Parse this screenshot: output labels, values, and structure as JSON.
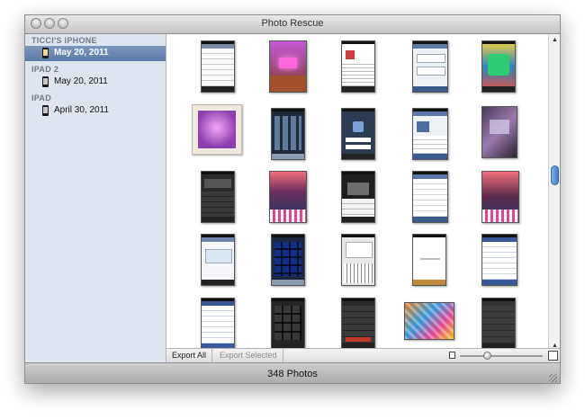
{
  "window": {
    "title": "Photo Rescue"
  },
  "sidebar": {
    "groups": [
      {
        "title": "TICCI'S IPHONE",
        "items": [
          {
            "label": "May 20, 2011",
            "selected": true
          }
        ]
      },
      {
        "title": "IPAD 2",
        "items": [
          {
            "label": "May 20, 2011",
            "selected": false
          }
        ]
      },
      {
        "title": "IPAD",
        "items": [
          {
            "label": "April 30, 2011",
            "selected": false
          }
        ]
      }
    ]
  },
  "toolbar": {
    "export_all": "Export All",
    "export_selected": "Export Selected",
    "zoom_level": 0.3
  },
  "status": {
    "count": "348 Photos"
  },
  "colors": {
    "selection": "#5a7ba8",
    "scroll_knob": "#3e7fd0",
    "sidebar_bg": "#dfe5ee"
  },
  "thumbnails": [
    {
      "kind": "settings screenshot"
    },
    {
      "kind": "purple desk photo"
    },
    {
      "kind": "web article screenshot"
    },
    {
      "kind": "web form screenshot"
    },
    {
      "kind": "colorful app screenshot"
    },
    {
      "kind": "purple monitor photo"
    },
    {
      "kind": "home screen screenshot"
    },
    {
      "kind": "app login screenshot"
    },
    {
      "kind": "messages screenshot"
    },
    {
      "kind": "desk photo"
    },
    {
      "kind": "dark app screenshot"
    },
    {
      "kind": "colorful poster photo"
    },
    {
      "kind": "dark settings screenshot"
    },
    {
      "kind": "list app screenshot"
    },
    {
      "kind": "colorful poster photo"
    },
    {
      "kind": "web page screenshot"
    },
    {
      "kind": "app store screenshot"
    },
    {
      "kind": "keyboard screenshot"
    },
    {
      "kind": "blank loading screenshot"
    },
    {
      "kind": "facebook screenshot"
    },
    {
      "kind": "facebook feed screenshot"
    },
    {
      "kind": "dark grid screenshot"
    },
    {
      "kind": "dark menu screenshot"
    },
    {
      "kind": "colorful artwork photo"
    },
    {
      "kind": "dark list screenshot"
    }
  ],
  "icons": {
    "window_close": "close-icon",
    "window_minimize": "minimize-icon",
    "window_zoom": "zoom-icon",
    "device": "iphone-icon",
    "zoom_small": "small-photo-icon",
    "zoom_large": "large-photo-icon",
    "resize": "resize-grip-icon"
  }
}
